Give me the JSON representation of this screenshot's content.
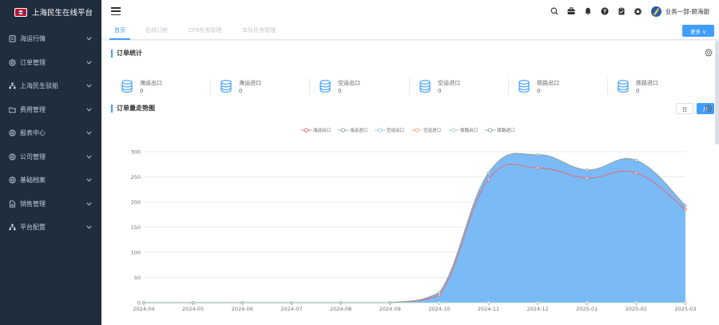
{
  "app": {
    "title": "上海民生在线平台"
  },
  "sidebar": {
    "items": [
      {
        "label": "海运行情",
        "icon": "document-icon"
      },
      {
        "label": "订单管理",
        "icon": "gear-icon"
      },
      {
        "label": "上海民生驳船",
        "icon": "network-icon"
      },
      {
        "label": "费用管理",
        "icon": "folder-icon"
      },
      {
        "label": "报表中心",
        "icon": "gear-icon"
      },
      {
        "label": "公司管理",
        "icon": "gear-icon"
      },
      {
        "label": "基础档案",
        "icon": "gear-icon"
      },
      {
        "label": "销售管理",
        "icon": "file-icon"
      },
      {
        "label": "平台配置",
        "icon": "network-icon"
      }
    ]
  },
  "header": {
    "user": "业务一部-顾海甜"
  },
  "tabs": [
    {
      "label": "首页",
      "active": true
    },
    {
      "label": "在线订舱",
      "active": false
    },
    {
      "label": "CFS任务管理",
      "active": false
    },
    {
      "label": "车队任务管理",
      "active": false
    }
  ],
  "more_button": "更多 ∨",
  "order_stats": {
    "title": "订单统计",
    "items": [
      {
        "label": "海运出口",
        "value": "0"
      },
      {
        "label": "海运进口",
        "value": "0"
      },
      {
        "label": "空运出口",
        "value": "0"
      },
      {
        "label": "空运进口",
        "value": "0"
      },
      {
        "label": "铁路出口",
        "value": "0"
      },
      {
        "label": "铁路进口",
        "value": "0"
      }
    ]
  },
  "trend": {
    "title": "订单量走势图",
    "day_label": "日",
    "month_label": "月"
  },
  "colors": {
    "accent": "#409eff",
    "sidebar_bg": "#1f2d3d",
    "area_fill": "#73b6f5",
    "sea_export_line": "#e0707a",
    "other_line": "#8fa5a3"
  },
  "chart_data": {
    "type": "area",
    "categories": [
      "2024-04",
      "2024-05",
      "2024-06",
      "2024-07",
      "2024-08",
      "2024-09",
      "2024-10",
      "2024-11",
      "2024-12",
      "2025-01",
      "2025-02",
      "2025-03"
    ],
    "ylim": [
      0,
      300
    ],
    "yticks": [
      "0",
      "50",
      "100",
      "150",
      "200",
      "250",
      "300"
    ],
    "grid": true,
    "legend_position": "top",
    "series": [
      {
        "name": "海运出口",
        "color": "#e0707a",
        "values": [
          0,
          0,
          0,
          0,
          0,
          0,
          15,
          245,
          268,
          248,
          258,
          185
        ]
      },
      {
        "name": "海运进口",
        "color": "#8fa5a3",
        "values": [
          0,
          0,
          0,
          0,
          0,
          0,
          0,
          0,
          0,
          0,
          0,
          0
        ]
      },
      {
        "name": "空运出口",
        "color": "#9ccfcd",
        "values": [
          0,
          0,
          0,
          0,
          0,
          0,
          0,
          0,
          0,
          0,
          0,
          0
        ]
      },
      {
        "name": "空运进口",
        "color": "#f0a58a",
        "values": [
          0,
          0,
          0,
          0,
          0,
          0,
          0,
          0,
          0,
          0,
          0,
          0
        ]
      },
      {
        "name": "铁路出口",
        "color": "#a9d9c6",
        "values": [
          0,
          0,
          0,
          0,
          0,
          0,
          0,
          0,
          0,
          0,
          0,
          0
        ]
      },
      {
        "name": "铁路进口",
        "color": "#8fa5a3",
        "values": [
          0,
          0,
          0,
          0,
          0,
          0,
          20,
          258,
          294,
          264,
          283,
          193
        ]
      }
    ]
  }
}
